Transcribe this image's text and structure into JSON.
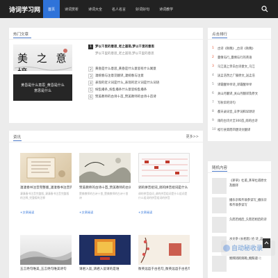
{
  "site": {
    "logo": "诗词学习网"
  },
  "nav": [
    {
      "label": "首页",
      "active": true
    },
    {
      "label": "诗词赏析",
      "active": false
    },
    {
      "label": "诗词大全",
      "active": false
    },
    {
      "label": "名人名言",
      "active": false
    },
    {
      "label": "好词好句",
      "active": false
    },
    {
      "label": "诗词教学",
      "active": false
    }
  ],
  "hot": {
    "title": "热门文章",
    "image_texts": [
      "美 之 意 境"
    ],
    "image2_caption": [
      "黄昏是什么意思_黄昏是什么",
      "意思是什么"
    ],
    "first": {
      "num": "1",
      "title": "梦以千里的意思_老之遥现,梦以千里的意思",
      "sub": "梦以千里的意思_老之遥现,梦以千里的意思"
    },
    "items": [
      {
        "num": "2",
        "text": "黄昏是什么意思_黄昏是什么意思有什么寓意"
      },
      {
        "num": "3",
        "text": "凄婉春与注意见翻译_凄婉春与注意"
      },
      {
        "num": "4",
        "text": "表现的近义词是什么_表现的近义词是什么词语"
      },
      {
        "num": "5",
        "text": "纷乱播条_纷乱播条什么意思纷乱播条"
      },
      {
        "num": "6",
        "text": "赞美教师的古诗十首_赞美教师的古诗十首诗"
      }
    ]
  },
  "news": {
    "title": "资讯",
    "more": "更多>>",
    "tiles": [
      {
        "title": "凄凄春书注音完整版_凄凄春书注音完整",
        "desc": "凄凄春书注音完整版_凄凄春书注音完整版的注释_完整版的注释",
        "link": "+文章阅读",
        "theme": "parchment"
      },
      {
        "title": "赞美教师的古诗十首_赞美教师的古诗十首",
        "desc": "赞美教师的古诗十首_赞美教师的古诗十首诗",
        "link": "+文章阅读",
        "theme": "ink"
      },
      {
        "title": "调的拼音组词_调的拼音组词是什么",
        "desc": "调的拼音组词_调的拼音组词是什么组词是什么组词的拼音组词的拼音",
        "link": "+文章阅读",
        "theme": "chart"
      }
    ],
    "tiles_bottom": [
      {
        "title": "五言绝句唯美_五言绝句唯美诗句",
        "theme": "mist"
      },
      {
        "title": "请君入瓮_请君入瓮请的是谁",
        "theme": "banner"
      },
      {
        "title": "衡英远邑于古名句_衡英远邑于古名句",
        "theme": "blossom"
      }
    ]
  },
  "rank": {
    "title": "点击排行",
    "items": [
      {
        "num": "1",
        "text": "古诗《秋晚》_古诗《秋晚》",
        "color": "#e4502f"
      },
      {
        "num": "2",
        "text": "曼倩岛行_曼倩岛行的英语",
        "color": "#e4502f"
      },
      {
        "num": "3",
        "text": "乌江遥上李白古诗意文_乌江",
        "color": "#e4502f"
      },
      {
        "num": "4",
        "text": "送孟浩然之广陵原文_送孟浩",
        "color": "#888888"
      },
      {
        "num": "5",
        "text": "译霜醒举举诗_译霜醒举举",
        "color": "#888888"
      },
      {
        "num": "6",
        "text": "关山月翻译_关山月翻译及原文",
        "color": "#888888"
      },
      {
        "num": "7",
        "text": "写秋伞的诗句",
        "color": "#888888"
      },
      {
        "num": "8",
        "text": "都天录词音_辛弃词和早颂诗",
        "color": "#888888"
      },
      {
        "num": "9",
        "text": "雨的古诗大全300首_雨的古诗",
        "color": "#888888"
      },
      {
        "num": "10",
        "text": "松行县第而四唐诗文翻译",
        "color": "#888888"
      }
    ]
  },
  "random": {
    "title": "随机内容",
    "items": [
      {
        "text": "《茅草》杜甫_茅草杜甫原文及翻译"
      },
      {
        "text": "播乐宗和齐翁参读写_播乐宗和齐翁参读写"
      },
      {
        "text": "久而若相后_久而若相后的诗"
      },
      {
        "text": "水文杂 (长相思) 拾 诗_这_"
      },
      {
        "text": "鲍照诗的诗的_鲍照诗"
      }
    ]
  },
  "watermark": {
    "title": "自动秘收录",
    "sub": "专业·高效·一久·自动"
  }
}
